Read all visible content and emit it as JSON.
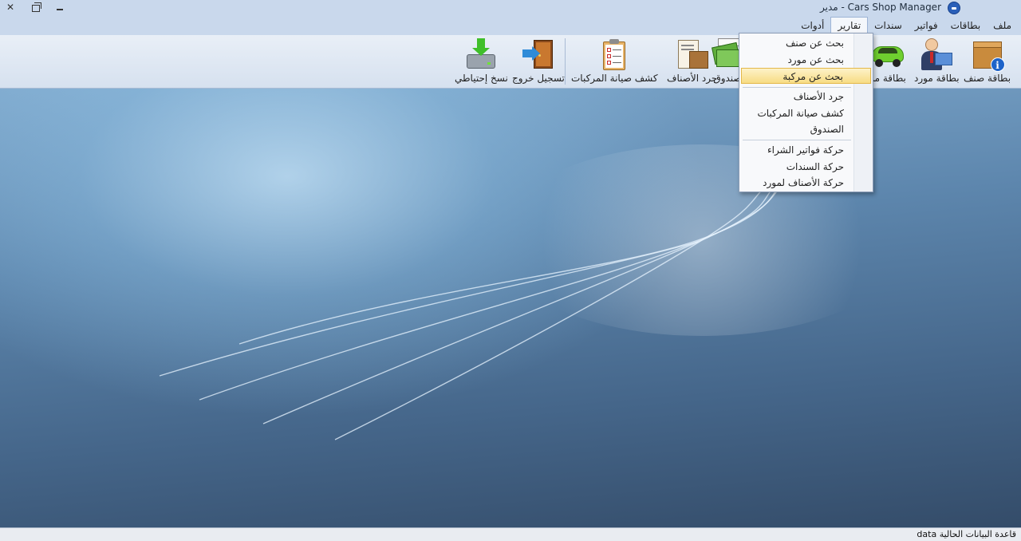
{
  "window": {
    "title": "Cars Shop Manager - مدير",
    "close_glyph": "✕"
  },
  "menubar": {
    "items": [
      "ملف",
      "بطاقات",
      "فواتير",
      "سندات",
      "تقارير",
      "أدوات"
    ],
    "active": "تقارير"
  },
  "toolbar": {
    "items": [
      {
        "label": "بطاقة صنف",
        "icon": "box-info-icon"
      },
      {
        "label": "بطاقة مورد",
        "icon": "supplier-card-icon"
      },
      {
        "label": "بطاقة مر",
        "icon": "car-icon"
      },
      {
        "label": "صندوق",
        "icon": "cash-icon"
      },
      {
        "label": "جرد الأصناف",
        "icon": "inventory-icon"
      },
      {
        "label": "كشف صيانة المركبات",
        "icon": "clipboard-icon"
      },
      {
        "label": "تسجيل خروج",
        "icon": "logout-door-icon"
      },
      {
        "label": "نسخ إحتياطي",
        "icon": "backup-drive-icon"
      }
    ]
  },
  "reports_menu": {
    "items": [
      "بحث عن صنف",
      "بحث عن مورد",
      "بحث عن مركبة",
      "جرد الأصناف",
      "كشف صيانة المركبات",
      "الصندوق",
      "حركة فواتير الشراء",
      "حركة السندات",
      "حركة الأصناف لمورد"
    ],
    "highlighted": "بحث عن مركبة"
  },
  "statusbar": {
    "text": "قاعدة البيانات الحالية data"
  },
  "colors": {
    "titlebar": "#c9d8ec",
    "highlight": "#f7dc84",
    "desktop_dark": "#344c69"
  }
}
